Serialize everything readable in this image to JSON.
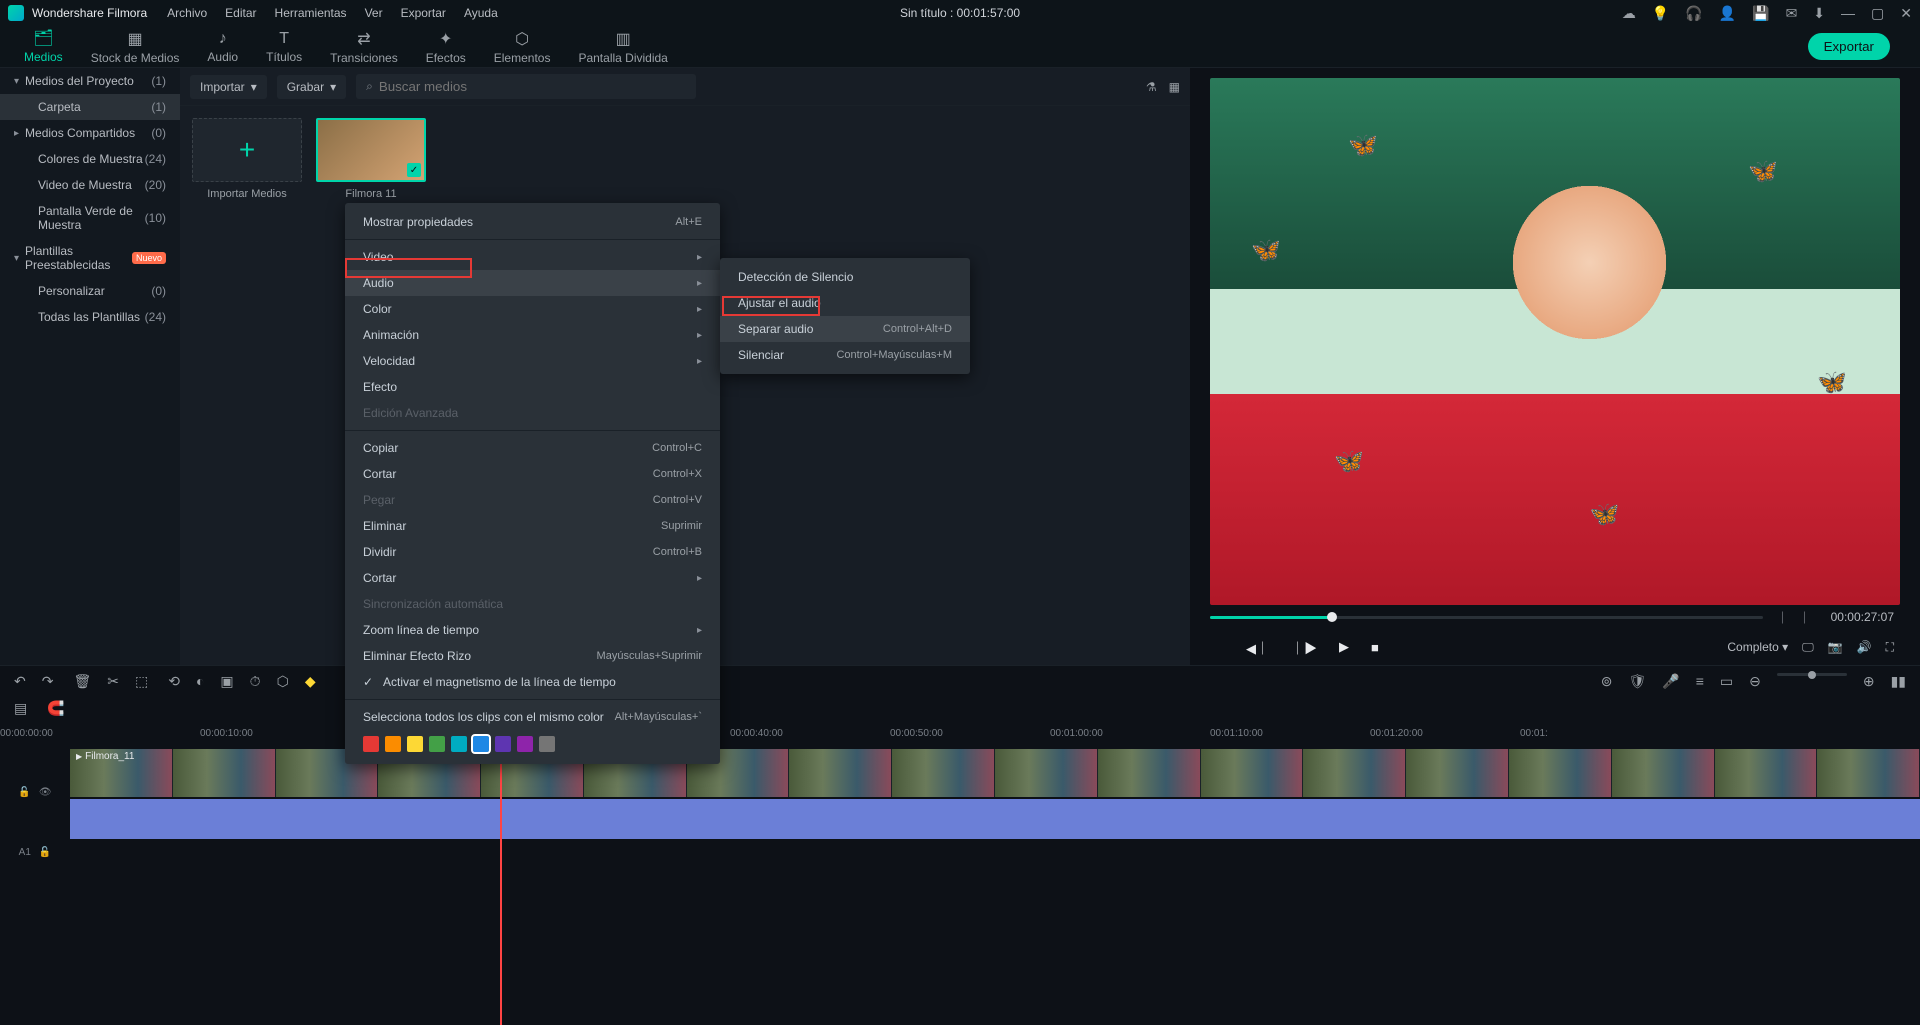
{
  "title": {
    "app": "Wondershare Filmora",
    "project": "Sin título",
    "duration": "00:01:57:00"
  },
  "menubar": [
    "Archivo",
    "Editar",
    "Herramientas",
    "Ver",
    "Exportar",
    "Ayuda"
  ],
  "tabs": [
    {
      "icon": "🗂",
      "label": "Medios"
    },
    {
      "icon": "▦",
      "label": "Stock de Medios"
    },
    {
      "icon": "♪",
      "label": "Audio"
    },
    {
      "icon": "T",
      "label": "Títulos"
    },
    {
      "icon": "⇄",
      "label": "Transiciones"
    },
    {
      "icon": "✦",
      "label": "Efectos"
    },
    {
      "icon": "⬡",
      "label": "Elementos"
    },
    {
      "icon": "▥",
      "label": "Pantalla Dividida"
    }
  ],
  "export_btn": "Exportar",
  "sidebar": {
    "items": [
      {
        "exp": "▾",
        "label": "Medios del Proyecto",
        "cnt": "(1)"
      },
      {
        "exp": "",
        "label": "Carpeta",
        "cnt": "(1)",
        "sub": true,
        "sel": true
      },
      {
        "exp": "▸",
        "label": "Medios Compartidos",
        "cnt": "(0)"
      },
      {
        "exp": "",
        "label": "Colores de Muestra",
        "cnt": "(24)",
        "sub": true
      },
      {
        "exp": "",
        "label": "Video de Muestra",
        "cnt": "(20)",
        "sub": true
      },
      {
        "exp": "",
        "label": "Pantalla Verde de Muestra",
        "cnt": "(10)",
        "sub": true
      },
      {
        "exp": "▾",
        "label": "Plantillas Preestablecidas",
        "cnt": "",
        "badge": "Nuevo"
      },
      {
        "exp": "",
        "label": "Personalizar",
        "cnt": "(0)",
        "sub": true
      },
      {
        "exp": "",
        "label": "Todas las Plantillas",
        "cnt": "(24)",
        "sub": true
      }
    ]
  },
  "media_toolbar": {
    "import": "Importar",
    "record": "Grabar",
    "search_ph": "Buscar medios"
  },
  "media_items": [
    {
      "label": "Importar Medios",
      "type": "import"
    },
    {
      "label": "Filmora 11",
      "type": "video"
    }
  ],
  "preview": {
    "time_current": "00:00:27:07",
    "quality": "Completo"
  },
  "ruler_ticks": [
    "00:00:00:00",
    "00:00:10:00",
    "00:00:40:00",
    "00:00:50:00",
    "00:01:00:00",
    "00:01:10:00",
    "00:01:20:00",
    "00:01:"
  ],
  "clip_label": "Filmora_11",
  "track_label_a": "A1",
  "context_menu": {
    "items": [
      {
        "label": "Mostrar propiedades",
        "shortcut": "Alt+E"
      },
      {
        "sep": true
      },
      {
        "label": "Video",
        "arrow": true
      },
      {
        "label": "Audio",
        "arrow": true,
        "hov": true,
        "hl": true
      },
      {
        "label": "Color",
        "arrow": true
      },
      {
        "label": "Animación",
        "arrow": true
      },
      {
        "label": "Velocidad",
        "arrow": true
      },
      {
        "label": "Efecto"
      },
      {
        "label": "Edición Avanzada",
        "disabled": true
      },
      {
        "sep": true
      },
      {
        "label": "Copiar",
        "shortcut": "Control+C"
      },
      {
        "label": "Cortar",
        "shortcut": "Control+X"
      },
      {
        "label": "Pegar",
        "shortcut": "Control+V",
        "disabled": true
      },
      {
        "label": "Eliminar",
        "shortcut": "Suprimir"
      },
      {
        "label": "Dividir",
        "shortcut": "Control+B"
      },
      {
        "label": "Cortar",
        "arrow": true
      },
      {
        "label": "Sincronización automática",
        "disabled": true
      },
      {
        "label": "Zoom línea de tiempo",
        "arrow": true
      },
      {
        "label": "Eliminar Efecto Rizo",
        "shortcut": "Mayúsculas+Suprimir"
      },
      {
        "label": "Activar el magnetismo de la línea de tiempo",
        "check": true
      },
      {
        "sep": true
      },
      {
        "label": "Selecciona todos los clips con el mismo color",
        "shortcut": "Alt+Mayúsculas+`"
      }
    ],
    "colors": [
      "#e53935",
      "#fb8c00",
      "#fdd835",
      "#43a047",
      "#00acc1",
      "#1e88e5",
      "#5e35b1",
      "#8e24aa",
      "#757575"
    ]
  },
  "submenu": {
    "items": [
      {
        "label": "Detección de Silencio"
      },
      {
        "label": "Ajustar el audio"
      },
      {
        "label": "Separar audio",
        "shortcut": "Control+Alt+D",
        "hov": true,
        "hl": true
      },
      {
        "label": "Silenciar",
        "shortcut": "Control+Mayúsculas+M"
      }
    ]
  }
}
